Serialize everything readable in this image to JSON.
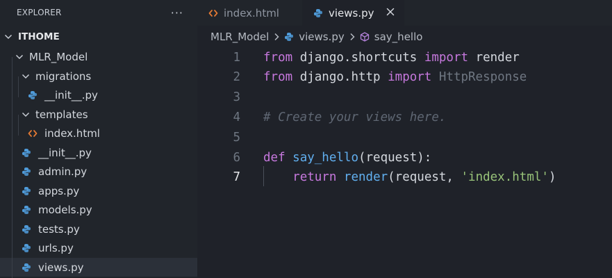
{
  "sidebar": {
    "title": "EXPLORER",
    "more": "···",
    "tree": [
      {
        "label": "ITHOME",
        "type": "root"
      },
      {
        "label": "MLR_Model",
        "type": "folder"
      },
      {
        "label": "migrations",
        "type": "folder"
      },
      {
        "label": "__init__.py",
        "type": "py"
      },
      {
        "label": "templates",
        "type": "folder"
      },
      {
        "label": "index.html",
        "type": "html"
      },
      {
        "label": "__init__.py",
        "type": "py"
      },
      {
        "label": "admin.py",
        "type": "py"
      },
      {
        "label": "apps.py",
        "type": "py"
      },
      {
        "label": "models.py",
        "type": "py"
      },
      {
        "label": "tests.py",
        "type": "py"
      },
      {
        "label": "urls.py",
        "type": "py"
      },
      {
        "label": "views.py",
        "type": "py",
        "selected": true
      }
    ]
  },
  "tabs": [
    {
      "label": "index.html",
      "active": false
    },
    {
      "label": "views.py",
      "active": true
    }
  ],
  "breadcrumb": {
    "folder": "MLR_Model",
    "file": "views.py",
    "symbol": "say_hello"
  },
  "editor": {
    "current_line": 7,
    "lines": [
      {
        "n": "1",
        "tokens": [
          [
            "kw",
            "from"
          ],
          [
            "plain",
            " django.shortcuts "
          ],
          [
            "kw",
            "import"
          ],
          [
            "plain",
            " render"
          ]
        ]
      },
      {
        "n": "2",
        "tokens": [
          [
            "kw",
            "from"
          ],
          [
            "plain",
            " django.http "
          ],
          [
            "kw",
            "import"
          ],
          [
            "dim",
            " HttpResponse"
          ]
        ]
      },
      {
        "n": "3",
        "tokens": []
      },
      {
        "n": "4",
        "tokens": [
          [
            "cmt",
            "# Create your views here."
          ]
        ]
      },
      {
        "n": "5",
        "tokens": []
      },
      {
        "n": "6",
        "tokens": [
          [
            "kw",
            "def"
          ],
          [
            "plain",
            " "
          ],
          [
            "fn",
            "say_hello"
          ],
          [
            "plain",
            "(request):"
          ]
        ]
      },
      {
        "n": "7",
        "tokens": [
          [
            "plain",
            "    "
          ],
          [
            "kw",
            "return"
          ],
          [
            "plain",
            " "
          ],
          [
            "fn",
            "render"
          ],
          [
            "plain",
            "(request, "
          ],
          [
            "str",
            "'index.html'"
          ],
          [
            "plain",
            ")"
          ]
        ]
      }
    ]
  },
  "colors": {
    "python_icon": "#4f9bd9",
    "html_icon": "#e37933",
    "symbol_icon": "#b180d7"
  }
}
